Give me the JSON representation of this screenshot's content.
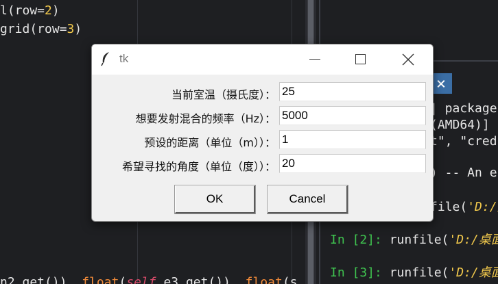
{
  "editor": {
    "line1": {
      "pre": "l(row=",
      "num": "2",
      "post": ")"
    },
    "line2": {
      "pre": "grid(row=",
      "num": "3",
      "post": ")"
    },
    "line3": {
      "a": "n2.get()), ",
      "fn1": "float",
      "b": "(",
      "kw": "self",
      "c": ".e3.get()), ",
      "fn2": "float",
      "d": "(s"
    }
  },
  "console": {
    "tab_close": "×",
    "line1": "| package",
    "line2": "(AMD64)]",
    "line3": "t\", \"cred",
    "line4": ") -- An en",
    "line5": {
      "a": "file(",
      "path": "'D:/桌面"
    },
    "in2": {
      "prompt": "In [2]:",
      "cmd": " runfile(",
      "path": "'D:/桌面"
    },
    "in3": {
      "prompt": "In [3]:",
      "cmd": " runfile(",
      "path": "'D:/桌面"
    }
  },
  "dialog": {
    "title": "tk",
    "icon": "feather-icon",
    "fields": [
      {
        "label": "当前室温（摄氏度）：",
        "value": "25"
      },
      {
        "label": "想要发射混合的频率（Hz）：",
        "value": "5000"
      },
      {
        "label": "预设的距离（单位（m））：",
        "value": "1"
      },
      {
        "label": "希望寻找的角度（单位（度））：",
        "value": "20"
      }
    ],
    "ok_label": "OK",
    "cancel_label": "Cancel"
  }
}
